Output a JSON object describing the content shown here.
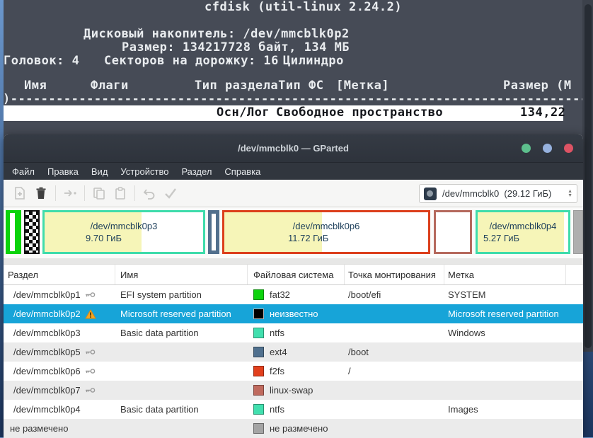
{
  "terminal": {
    "title_line": "cfdisk (util-linux 2.24.2)",
    "disk_line": "Дисковый накопитель: /dev/mmcblk0p2",
    "size_line": "Размер: 134217728 байт, 134 МБ",
    "geometry": {
      "heads": "Головок: 4",
      "sectors": "Секторов на дорожку: 16",
      "cylinders": "Цилиндро"
    },
    "columns": {
      "name": "Имя",
      "flags": "Флаги",
      "type_fs": "Тип разделаТип ФС",
      "label": "[Метка]",
      "size": "Размер (М"
    },
    "separator_line": ")----------------------------------------------------------------------------",
    "highlight_row": {
      "type": "Осн/Лог",
      "fs": "Свободное пространство",
      "size": "134,22"
    }
  },
  "gparted": {
    "title": "/dev/mmcblk0 — GParted",
    "window_buttons": {
      "colors": [
        "#5dbf8d",
        "#96b1de",
        "#dd5364"
      ]
    },
    "menu": {
      "file": "Файл",
      "edit": "Правка",
      "view": "Вид",
      "device": "Устройство",
      "partition": "Раздел",
      "help": "Справка"
    },
    "toolbar": {
      "buttons": [
        "add-partition",
        "delete-partition",
        "resize-move",
        "copy",
        "paste",
        "undo",
        "apply"
      ],
      "device_combo": "/dev/mmcblk0  (29.12 ГиБ)"
    },
    "diskbar": {
      "used_color": "#f6f5b8",
      "segments": [
        {
          "fs": "fat32",
          "border": "#0bd30b"
        },
        {
          "fs": "unknown",
          "border": "#111111",
          "selected": true
        },
        {
          "name": "/dev/mmcblk0p3",
          "size": "9.70 ГиБ",
          "fs": "ntfs",
          "border": "#3fdcab",
          "used_pct": 61
        },
        {
          "fs": "ext4",
          "border": "#52708d"
        },
        {
          "name": "/dev/mmcblk0p6",
          "size": "11.72 ГиБ",
          "fs": "f2fs",
          "border": "#dc3f1c",
          "used_pct": 48
        },
        {
          "fs": "linux-swap",
          "border": "#b5695d"
        },
        {
          "name": "/dev/mmcblk0p4",
          "size": "5.27 ГиБ",
          "fs": "ntfs",
          "border": "#3fdcab",
          "used_pct": 95
        },
        {
          "fs": "unallocated",
          "bg": "#afafaf"
        }
      ]
    },
    "table": {
      "headers": {
        "partition": "Раздел",
        "name": "Имя",
        "filesystem": "Файловая система",
        "mountpoint": "Точка монтирования",
        "label": "Метка"
      },
      "rows": [
        {
          "device": "/dev/mmcblk0p1",
          "icon": "key",
          "name": "EFI system partition",
          "fs": "fat32",
          "fs_color": "#0dd30d",
          "mount": "/boot/efi",
          "label": "SYSTEM"
        },
        {
          "device": "/dev/mmcblk0p2",
          "icon": "warning",
          "name": "Microsoft reserved partition",
          "fs": "неизвестно",
          "fs_color": "#000000",
          "mount": "",
          "label": "Microsoft reserved partition",
          "selected": true
        },
        {
          "device": "/dev/mmcblk0p3",
          "icon": "",
          "name": "Basic data partition",
          "fs": "ntfs",
          "fs_color": "#41dfae",
          "mount": "",
          "label": "Windows"
        },
        {
          "device": "/dev/mmcblk0p5",
          "icon": "key",
          "name": "",
          "fs": "ext4",
          "fs_color": "#50708e",
          "mount": "/boot",
          "label": ""
        },
        {
          "device": "/dev/mmcblk0p6",
          "icon": "key",
          "name": "",
          "fs": "f2fs",
          "fs_color": "#e2401d",
          "mount": "/",
          "label": ""
        },
        {
          "device": "/dev/mmcblk0p7",
          "icon": "key",
          "name": "",
          "fs": "linux-swap",
          "fs_color": "#bf6a5e",
          "mount": "",
          "label": ""
        },
        {
          "device": "/dev/mmcblk0p4",
          "icon": "",
          "name": "Basic data partition",
          "fs": "ntfs",
          "fs_color": "#41dfae",
          "mount": "",
          "label": "Images"
        },
        {
          "device": "не размечено",
          "icon": "",
          "name": "",
          "fs": "не размечено",
          "fs_color": "#a4a4a4",
          "mount": "",
          "label": ""
        }
      ]
    }
  }
}
